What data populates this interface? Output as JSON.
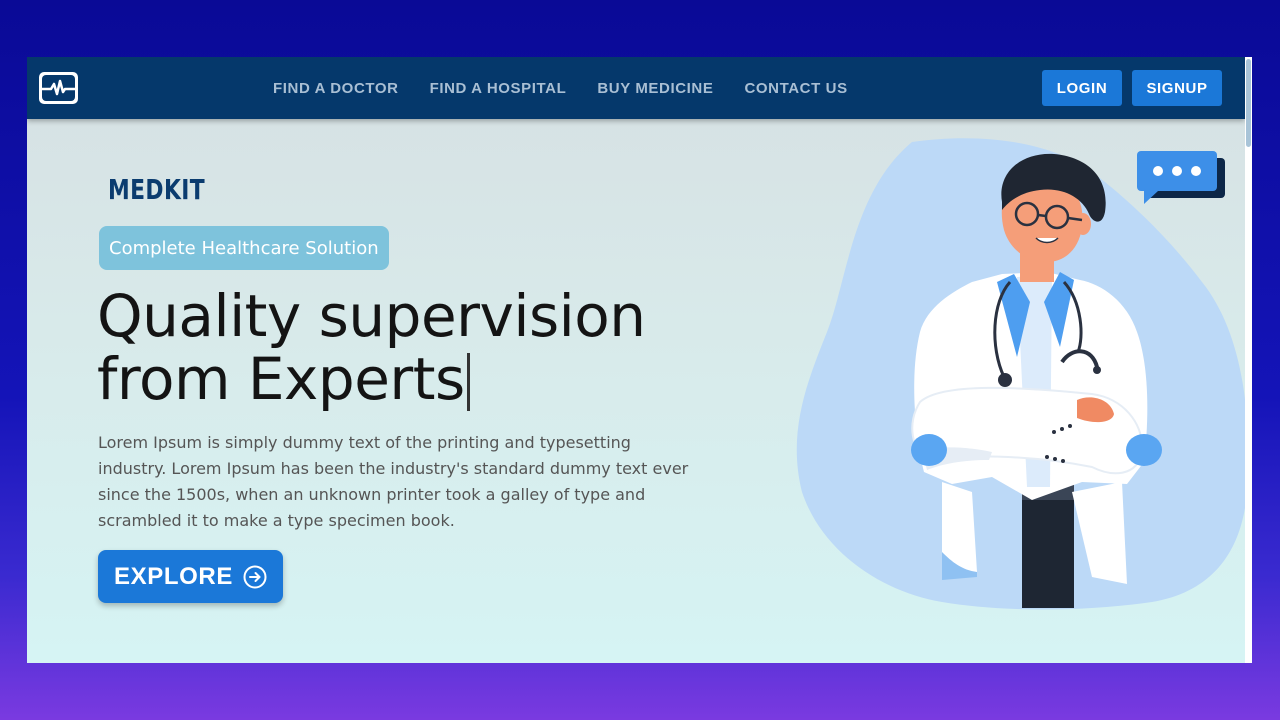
{
  "navbar": {
    "logo_icon": "heartbeat-icon",
    "links": [
      "FIND A DOCTOR",
      "FIND A HOSPITAL",
      "BUY MEDICINE",
      "CONTACT US"
    ],
    "login_label": "LOGIN",
    "signup_label": "SIGNUP"
  },
  "hero": {
    "brand": "MEDKIT",
    "tag": "Complete Healthcare Solution",
    "headline_line1": "Quality supervision",
    "headline_line2": "from Experts",
    "description": "Lorem Ipsum is simply dummy text of the printing and typesetting industry. Lorem Ipsum has been the industry's standard dummy text ever since the 1500s, when an unknown printer took a galley of type and scrambled it to make a type specimen book.",
    "cta_label": "EXPLORE",
    "cta_icon": "arrow-right-circle-icon",
    "illustration": "doctor-illustration"
  },
  "colors": {
    "navbar_bg": "#05386b",
    "accent": "#1b78d8",
    "tag_bg": "#7ec3dc",
    "brand": "#0b3c6f"
  }
}
